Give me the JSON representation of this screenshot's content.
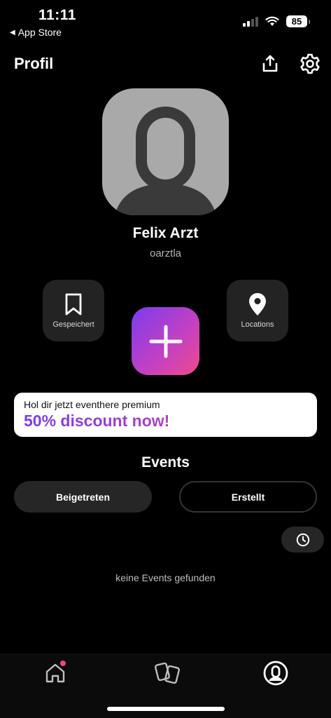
{
  "status_bar": {
    "time": "11:11",
    "back_app": "App Store",
    "battery": "85",
    "signal_bars": 2,
    "signal_bars_total": 4
  },
  "header": {
    "title": "Profil",
    "icons": [
      "share-icon",
      "gear-icon"
    ]
  },
  "profile": {
    "name": "Felix Arzt",
    "username": "oarztla"
  },
  "actions": {
    "saved_label": "Gespeichert",
    "locations_label": "Locations",
    "add_icon": "plus-icon"
  },
  "promo": {
    "line1": "Hol dir jetzt eventhere premium",
    "line2": "50% discount now!"
  },
  "events": {
    "title": "Events",
    "tabs": [
      {
        "label": "Beigetreten",
        "active": true
      },
      {
        "label": "Erstellt",
        "active": false
      }
    ],
    "empty_message": "keine Events gefunden"
  },
  "tabbar": {
    "items": [
      "home-icon",
      "cards-icon",
      "profile-icon"
    ],
    "active": "profile-icon"
  },
  "colors": {
    "background": "#000000",
    "accent_start": "#7b3cf0",
    "accent_end": "#ef4a8e",
    "surface": "#232323",
    "notification": "#f0457f"
  }
}
